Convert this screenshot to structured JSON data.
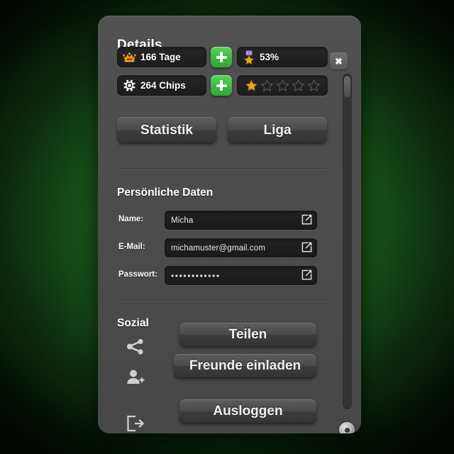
{
  "window": {
    "title": "Details"
  },
  "close": {
    "label": "✖",
    "icon": "close-icon"
  },
  "stats": {
    "days": {
      "icon": "crown-icon",
      "value": "166 Tage",
      "add_label": "+"
    },
    "chips": {
      "icon": "poker-chip-icon",
      "value": "264 Chips",
      "add_label": "+"
    },
    "percent": {
      "icon": "medal-icon",
      "value": "53%"
    },
    "rating": {
      "filled": 1,
      "total": 5,
      "icon": "star-icon"
    }
  },
  "nav": {
    "statistik_label": "Statistik",
    "liga_label": "Liga"
  },
  "personal": {
    "heading": "Persönliche Daten",
    "fields": [
      {
        "label": "Name:",
        "value": "Micha",
        "edit_icon": "edit-icon"
      },
      {
        "label": "E-Mail:",
        "value": "michamuster@gmail.com",
        "edit_icon": "edit-icon"
      },
      {
        "label": "Passwort:",
        "value": "••••••••••••",
        "edit_icon": "edit-icon"
      }
    ]
  },
  "social": {
    "heading": "Sozial",
    "share": {
      "icon": "share-icon",
      "label": "Teilen"
    },
    "invite": {
      "icon": "add-person-icon",
      "label": "Freunde einladen"
    },
    "logout": {
      "icon": "logout-icon",
      "label": "Ausloggen"
    }
  },
  "colors": {
    "felt_green": "#18581a",
    "panel_grey": "#4b4b4b",
    "accent_green": "#3cbb42",
    "gold": "#e8a81c",
    "pill_dark": "#1f1f1f"
  }
}
